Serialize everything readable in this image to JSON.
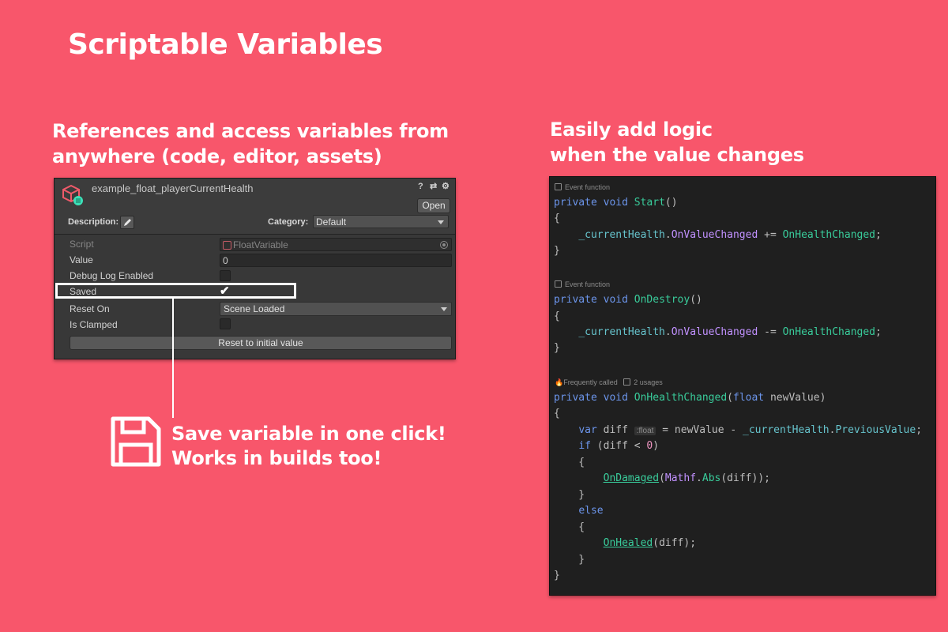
{
  "page": {
    "title": "Scriptable Variables",
    "left_subtitle": [
      "References and access variables from",
      "anywhere (code, editor, assets)"
    ],
    "right_subtitle": [
      "Easily add logic",
      "when the value changes"
    ],
    "callout": [
      "Save variable in one click!",
      "Works in builds too!"
    ],
    "background_color": "#f8566b"
  },
  "inspector": {
    "asset_name": "example_float_playerCurrentHealth",
    "open_label": "Open",
    "description_label": "Description:",
    "category_label": "Category:",
    "category_value": "Default",
    "rows": {
      "script_label": "Script",
      "script_value": "FloatVariable",
      "value_label": "Value",
      "value_value": "0",
      "debug_label": "Debug Log Enabled",
      "debug_checked": false,
      "saved_label": "Saved",
      "saved_checked": true,
      "reset_on_label": "Reset On",
      "reset_on_value": "Scene Loaded",
      "clamped_label": "Is Clamped",
      "clamped_checked": false
    },
    "reset_button_label": "Reset to initial value",
    "header_icons": [
      "help-icon",
      "presets-icon",
      "settings-icon"
    ]
  },
  "code": {
    "hint_event_function": "Event function",
    "hint_frequently_called": "Frequently called",
    "hint_usages": "2 usages",
    "type_hint": ":float",
    "colors": {
      "keyword": "#6c95eb",
      "method": "#39cc9b",
      "property": "#c191ff",
      "field": "#66c3cc",
      "number": "#ed94c0"
    }
  }
}
